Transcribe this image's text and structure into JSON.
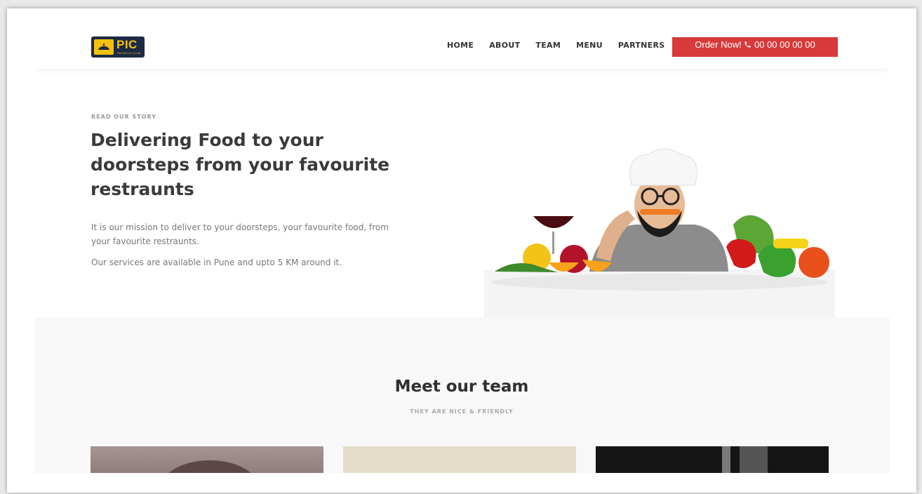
{
  "brand": {
    "logo_text": "PIC",
    "logo_sub": "PATNA IN CLUB"
  },
  "nav": {
    "items": [
      "HOME",
      "ABOUT",
      "TEAM",
      "MENU",
      "PARTNERS"
    ]
  },
  "order_button": {
    "label": "Order Now!",
    "phone": "00 00 00 00 00"
  },
  "hero": {
    "eyebrow": "READ OUR STORY",
    "title": "Delivering Food to your doorsteps from your favourite restraunts",
    "p1": "It is our mission to deliver to your doorsteps, your favourite food, from your favourite restraunts.",
    "p2": "Our services are available in Pune and upto 5 KM around it."
  },
  "team": {
    "title": "Meet our team",
    "subtitle": "THEY ARE NICE & FRIENDLY"
  },
  "colors": {
    "accent": "#d63a3a",
    "logo_bg": "#1d2a44",
    "logo_yellow": "#f4c20d"
  }
}
